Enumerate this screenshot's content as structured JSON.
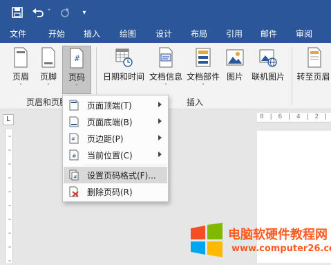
{
  "qat": {
    "save": "💾",
    "undo": "↶",
    "undo_more": "˅",
    "redo": "↻",
    "customize": "▾"
  },
  "menu": {
    "tabs": [
      "文件",
      "开始",
      "插入",
      "绘图",
      "设计",
      "布局",
      "引用",
      "邮件",
      "审阅"
    ],
    "active_tab": "插入"
  },
  "ribbon": {
    "buttons": {
      "header": "页眉",
      "footer": "页脚",
      "page_number": "页码",
      "datetime": "日期和时间",
      "docinfo": "文档信息",
      "docparts": "文档部件",
      "picture": "图片",
      "online_picture": "联机图片",
      "goto_header": "转至页眉"
    },
    "groups": {
      "header_footer": "页眉和页脚",
      "insert": "插入"
    },
    "chevron": "˅"
  },
  "dropdown": {
    "items": [
      {
        "label": "页面顶端(T)",
        "submenu": true
      },
      {
        "label": "页面底端(B)",
        "submenu": true
      },
      {
        "label": "页边距(P)",
        "submenu": true
      },
      {
        "label": "当前位置(C)",
        "submenu": true
      },
      {
        "label": "设置页码格式(F)...",
        "submenu": false,
        "highlighted": true
      },
      {
        "label": "删除页码(R)",
        "submenu": false
      }
    ]
  },
  "ruler": {
    "tab_selector": "L",
    "marks": "8 | 6 | 4 | 2 |"
  },
  "watermark": {
    "title": "电脑软硬件教程网",
    "url": "www.computer26.com"
  },
  "colors": {
    "brand": "#2b579a",
    "watermark": "#ff5a1f"
  }
}
